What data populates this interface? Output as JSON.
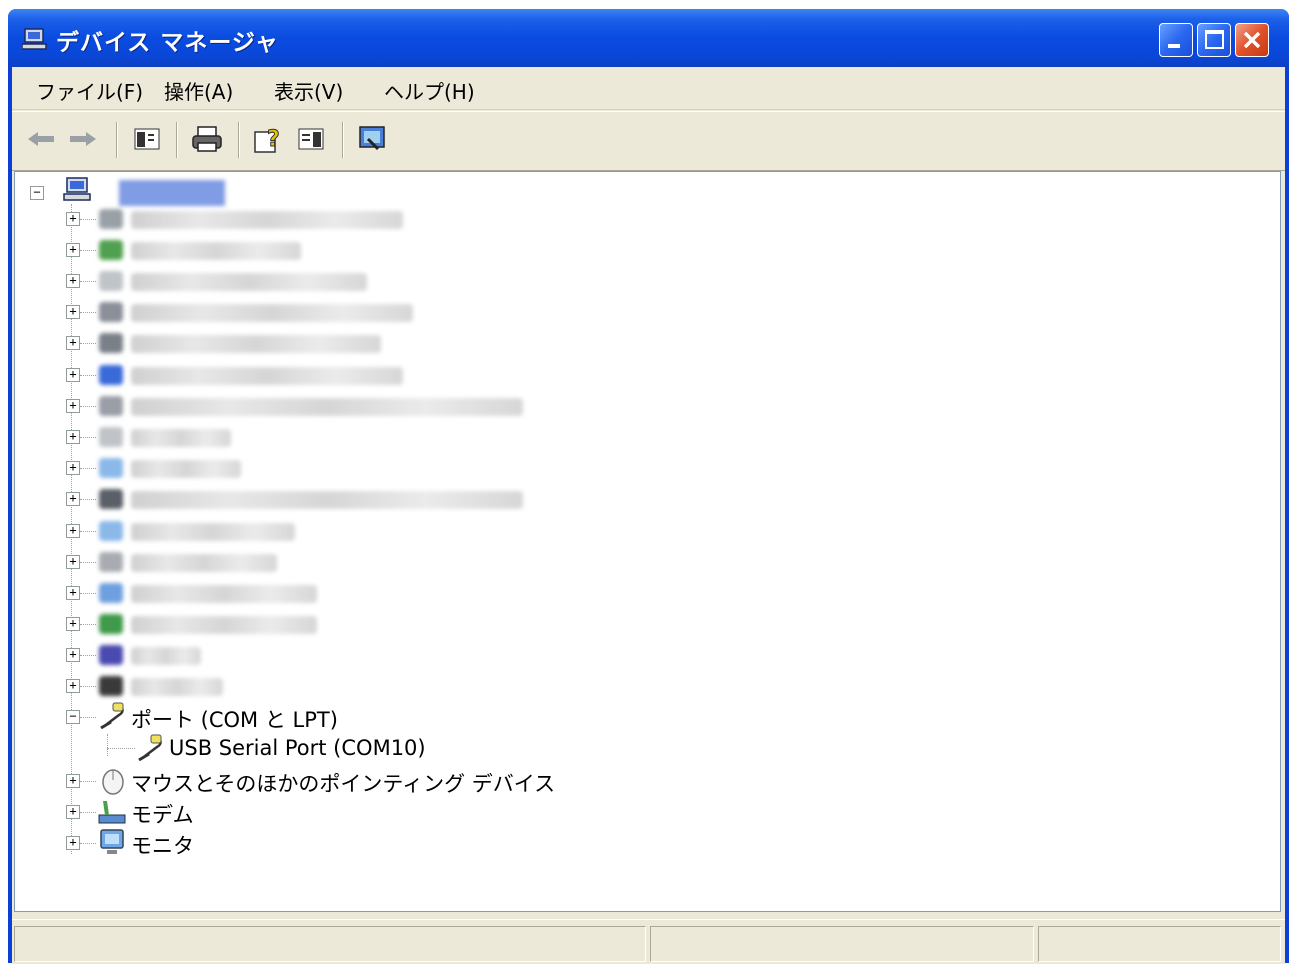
{
  "window": {
    "title": "デバイス マネージャ"
  },
  "menu": {
    "items": [
      {
        "label": "ファイル(F)"
      },
      {
        "label": "操作(A)"
      },
      {
        "label": "表示(V)"
      },
      {
        "label": "ヘルプ(H)"
      }
    ]
  },
  "toolbar": {
    "icons": [
      "back-arrow-icon",
      "forward-arrow-icon",
      "show-hide-tree-icon",
      "print-icon",
      "help-icon",
      "properties-icon",
      "scan-hardware-icon"
    ]
  },
  "tree": {
    "ports_label": "ポート (COM と LPT)",
    "ports_child_label": "USB Serial Port (COM10)",
    "mouse_label": "マウスとそのほかのポインティング デバイス",
    "modem_label": "モデム",
    "monitor_label": "モニタ",
    "blurred_note": "hidden"
  },
  "colors": {
    "titlebar": "#0a4be0",
    "chrome": "#ece9d8",
    "close_button": "#e0512a"
  }
}
